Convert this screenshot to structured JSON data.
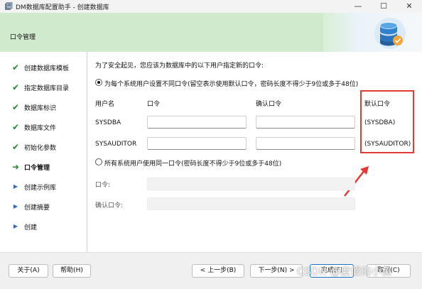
{
  "window": {
    "title": "DM数据库配置助手 - 创建数据库",
    "buttons": {
      "minimize": "—",
      "maximize": "☐",
      "close": "✕"
    }
  },
  "banner": {
    "heading": "口令管理"
  },
  "nav": {
    "items": [
      {
        "label": "创建数据库模板",
        "state": "done"
      },
      {
        "label": "指定数据库目录",
        "state": "done"
      },
      {
        "label": "数据库标识",
        "state": "done"
      },
      {
        "label": "数据库文件",
        "state": "done"
      },
      {
        "label": "初始化参数",
        "state": "done"
      },
      {
        "label": "口令管理",
        "state": "current"
      },
      {
        "label": "创建示例库",
        "state": "pending"
      },
      {
        "label": "创建摘要",
        "state": "pending"
      },
      {
        "label": "创建",
        "state": "pending"
      }
    ]
  },
  "main": {
    "intro": "为了安全起见，您应该为数据库中的以下用户指定新的口令:",
    "option_individual": {
      "label": "为每个系统用户设置不同口令(留空表示使用默认口令，密码长度不得少于9位或多于48位)",
      "selected": true
    },
    "columns": {
      "user": "用户名",
      "password": "口令",
      "confirm": "确认口令",
      "default": "默认口令"
    },
    "rows": [
      {
        "user": "SYSDBA",
        "password": "",
        "confirm": "",
        "default": "(SYSDBA)"
      },
      {
        "user": "SYSAUDITOR",
        "password": "",
        "confirm": "",
        "default": "(SYSAUDITOR)"
      }
    ],
    "option_same": {
      "label": "所有系统用户使用同一口令(密码长度不得少于9位或多于48位)",
      "selected": false
    },
    "same_password_label": "口令:",
    "same_confirm_label": "确认口令:"
  },
  "footer": {
    "about": "关于(A)",
    "help": "帮助(H)",
    "back": "< 上一步(B)",
    "next": "下一步(N) >",
    "finish": "完成(F)",
    "cancel": "取消(C)"
  },
  "watermark": "CSDN @度假的小鱼",
  "colors": {
    "banner": "#cfeacd",
    "check": "#1f8a2e",
    "pending": "#2b6cc4",
    "highlight": "#e53935"
  }
}
